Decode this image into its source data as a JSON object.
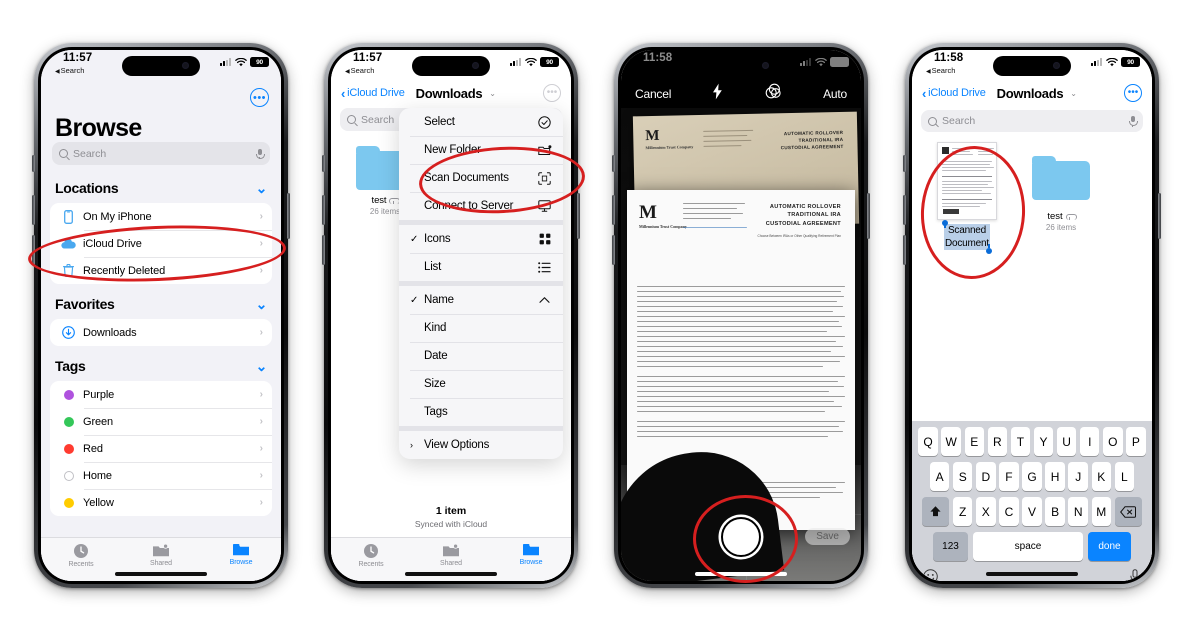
{
  "phones": {
    "p1": {
      "status": {
        "time": "11:57",
        "back_label": "Search",
        "battery": "90"
      },
      "title": "Browse",
      "search": {
        "placeholder": "Search"
      },
      "sections": [
        {
          "header": "Locations",
          "items": [
            {
              "label": "On My iPhone",
              "icon": "iphone-icon"
            },
            {
              "label": "iCloud Drive",
              "icon": "cloud-icon"
            },
            {
              "label": "Recently Deleted",
              "icon": "trash-icon"
            }
          ]
        },
        {
          "header": "Favorites",
          "items": [
            {
              "label": "Downloads",
              "icon": "download-circle-icon"
            }
          ]
        },
        {
          "header": "Tags",
          "items": [
            {
              "label": "Purple",
              "color": "#af52de"
            },
            {
              "label": "Green",
              "color": "#34c759"
            },
            {
              "label": "Red",
              "color": "#ff3b30"
            },
            {
              "label": "Home",
              "color": "#ffffff"
            },
            {
              "label": "Yellow",
              "color": "#ffcc00"
            }
          ]
        }
      ],
      "tabs": [
        {
          "label": "Recents",
          "icon": "clock-icon",
          "active": false
        },
        {
          "label": "Shared",
          "icon": "shared-folder-icon",
          "active": false
        },
        {
          "label": "Browse",
          "icon": "folder-icon",
          "active": true
        }
      ]
    },
    "p2": {
      "status": {
        "time": "11:57",
        "back_label": "Search",
        "battery": "90"
      },
      "nav": {
        "back": "iCloud Drive",
        "title": "Downloads"
      },
      "search": {
        "placeholder": "Search"
      },
      "folder": {
        "name": "test",
        "count": "26 items"
      },
      "menu_groups": [
        {
          "items": [
            {
              "label": "Select",
              "icon": "check-circle-icon",
              "check": false
            },
            {
              "label": "New Folder",
              "icon": "new-folder-icon",
              "check": false
            },
            {
              "label": "Scan Documents",
              "icon": "scan-icon",
              "check": false
            },
            {
              "label": "Connect to Server",
              "icon": "monitor-icon",
              "check": false
            }
          ]
        },
        {
          "items": [
            {
              "label": "Icons",
              "icon": "grid-icon",
              "check": true
            },
            {
              "label": "List",
              "icon": "list-icon",
              "check": false
            }
          ]
        },
        {
          "items": [
            {
              "label": "Name",
              "icon": "chevron-up-icon",
              "check": true
            },
            {
              "label": "Kind",
              "icon": "",
              "check": false
            },
            {
              "label": "Date",
              "icon": "",
              "check": false
            },
            {
              "label": "Size",
              "icon": "",
              "check": false
            },
            {
              "label": "Tags",
              "icon": "",
              "check": false
            }
          ]
        },
        {
          "items": [
            {
              "label": "View Options",
              "icon": "",
              "check": false,
              "leading": "chevron-right-icon"
            }
          ]
        }
      ],
      "footer": {
        "count": "1 item",
        "sync": "Synced with iCloud"
      },
      "tabs": [
        {
          "label": "Recents",
          "icon": "clock-icon",
          "active": false
        },
        {
          "label": "Shared",
          "icon": "shared-folder-icon",
          "active": false
        },
        {
          "label": "Browse",
          "icon": "folder-icon",
          "active": true
        }
      ]
    },
    "p3": {
      "status": {
        "time": "11:58",
        "battery": ""
      },
      "controls": {
        "cancel": "Cancel",
        "flash": "flash-icon",
        "filter": "filter-icon",
        "auto": "Auto"
      },
      "save_label": "Save",
      "document": {
        "logo": "M",
        "logo_sub": "Millennium Trust Company",
        "title_lines": [
          "AUTOMATIC ROLLOVER",
          "TRADITIONAL IRA",
          "CUSTODIAL AGREEMENT"
        ],
        "subtitle": "Choose Between IRAs or Other Qualifying Retirement Plan"
      }
    },
    "p4": {
      "status": {
        "time": "11:58",
        "back_label": "Search",
        "battery": "90"
      },
      "nav": {
        "back": "iCloud Drive",
        "title": "Downloads"
      },
      "search": {
        "placeholder": "Search"
      },
      "items": [
        {
          "name_line1": "Scanned",
          "name_line2": "Document",
          "type": "document",
          "selected": true
        },
        {
          "name": "test",
          "count": "26 items",
          "type": "folder"
        }
      ],
      "keyboard": {
        "row1": [
          "Q",
          "W",
          "E",
          "R",
          "T",
          "Y",
          "U",
          "I",
          "O",
          "P"
        ],
        "row2": [
          "A",
          "S",
          "D",
          "F",
          "G",
          "H",
          "J",
          "K",
          "L"
        ],
        "row3": [
          "Z",
          "X",
          "C",
          "V",
          "B",
          "N",
          "M"
        ],
        "shift": "shift-icon",
        "backspace": "backspace-icon",
        "numbers": "123",
        "space": "space",
        "done": "done",
        "emoji": "emoji-icon",
        "dictation": "microphone-icon"
      }
    }
  },
  "annotations": [
    {
      "target": "icloud-drive-row",
      "shape": "ellipse"
    },
    {
      "target": "scan-documents-item",
      "shape": "ellipse"
    },
    {
      "target": "shutter-button",
      "shape": "ellipse"
    },
    {
      "target": "scanned-document-item",
      "shape": "ellipse"
    }
  ]
}
